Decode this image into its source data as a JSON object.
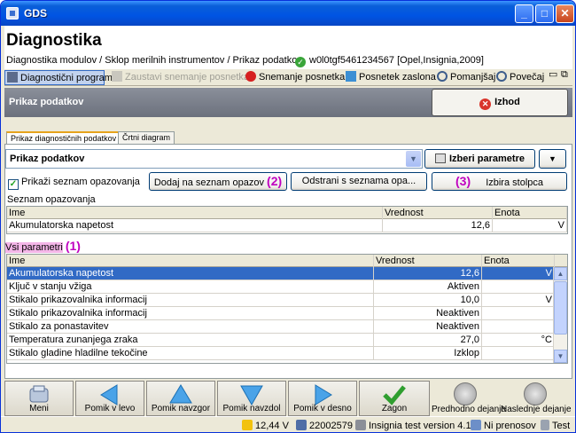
{
  "window": {
    "title": "GDS"
  },
  "header": {
    "title": "Diagnostika",
    "breadcrumb": "Diagnostika modulov / Sklop merilnih instrumentov / Prikaz podatkov",
    "vehicle": "w0l0tgf5461234567 [Opel,Insignia,2009]"
  },
  "toolbar": {
    "diag_program": "Diagnostični program",
    "stop_recording": "Zaustavi snemanje posnetka",
    "recording": "Snemanje posnetka",
    "screenshot": "Posnetek zaslona",
    "zoom_out": "Pomanjšaj",
    "zoom_in": "Povečaj"
  },
  "panel": {
    "title": "Prikaz podatkov",
    "exit_label": "Izhod"
  },
  "tabs": [
    {
      "label": "Prikaz diagnostičnih podatkov"
    },
    {
      "label": "Črtni diagram"
    }
  ],
  "combo": {
    "value": "Prikaz podatkov"
  },
  "buttons": {
    "select_params": "Izberi parametre",
    "add_watch": "Dodaj na seznam opazov",
    "remove_watch": "Odstrani s seznama opa...",
    "select_column": "Izbira stolpca"
  },
  "watch": {
    "checkbox_label": "Prikaži seznam opazovanja",
    "section_label": "Seznam opazovanja",
    "columns": [
      "Ime",
      "Vrednost",
      "Enota"
    ],
    "rows": [
      [
        "Akumulatorska napetost",
        "12,6",
        "V"
      ]
    ]
  },
  "all": {
    "section_label": "Vsi parametri",
    "columns": [
      "Ime",
      "Vrednost",
      "Enota"
    ],
    "rows": [
      [
        "Akumulatorska napetost",
        "12,6",
        "V"
      ],
      [
        "Ključ v stanju vžiga",
        "Aktiven",
        ""
      ],
      [
        "Stikalo prikazovalnika informacij",
        "10,0",
        "V"
      ],
      [
        "Stikalo prikazovalnika informacij",
        "Neaktiven",
        ""
      ],
      [
        "Stikalo za ponastavitev",
        "Neaktiven",
        ""
      ],
      [
        "Temperatura zunanjega zraka",
        "27,0",
        "°C"
      ],
      [
        "Stikalo gladine hladilne tekočine",
        "Izklop",
        ""
      ]
    ]
  },
  "annotations": {
    "one": "(1)",
    "two": "(2)",
    "three": "(3)"
  },
  "nav": {
    "menu": "Meni",
    "left": "Pomik v levo",
    "up": "Pomik navzgor",
    "down": "Pomik navzdol",
    "right": "Pomik v desno",
    "start": "Zagon",
    "prev_action": "Predhodno dejanje",
    "next_action": "Naslednje dejanje"
  },
  "statusbar": {
    "voltage": "12,44 V",
    "id": "22002579",
    "version": "Insignia test version 4.1",
    "transfer": "Ni prenosov",
    "mode": "Test"
  },
  "colors": {
    "titlebar": "#0054e3",
    "selection": "#316ac5",
    "annotation": "#c000c0",
    "highlight": "#f4b6e8"
  }
}
